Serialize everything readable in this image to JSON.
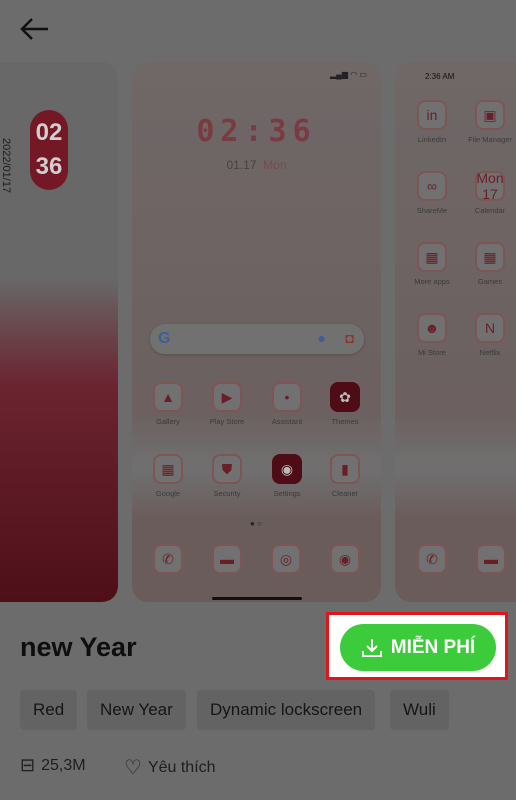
{
  "header": {
    "back_icon": "arrow-left-icon"
  },
  "previews": {
    "lockscreen": {
      "hour": "02",
      "minute": "36",
      "date": "2022/01/17"
    },
    "home": {
      "clock": "02:36",
      "date": "01.17",
      "day": "Mon",
      "apps": [
        {
          "label": "Gallery"
        },
        {
          "label": "Play Store"
        },
        {
          "label": "Assistant"
        },
        {
          "label": "Themes"
        },
        {
          "label": "Google"
        },
        {
          "label": "Security"
        },
        {
          "label": "Settings"
        },
        {
          "label": "Cleaner"
        }
      ]
    },
    "drawer": {
      "time": "2:36 AM",
      "apps": [
        {
          "label": "LinkedIn"
        },
        {
          "label": "File Manager"
        },
        {
          "label": "ShareMe"
        },
        {
          "label": "Calendar"
        },
        {
          "label": "More apps"
        },
        {
          "label": "Games"
        },
        {
          "label": "Mi Store"
        },
        {
          "label": "Netflix"
        }
      ],
      "calendar_icon": {
        "day": "Mon",
        "date": "17"
      }
    }
  },
  "theme": {
    "title": "new Year",
    "download_label": "MIỄN PHÍ",
    "tags": [
      "Red",
      "New Year",
      "Dynamic lockscreen",
      "Wuli"
    ],
    "size": "25,3M",
    "favorite_label": "Yêu thích"
  },
  "colors": {
    "accent": "#3ccb3a",
    "highlight": "#e0141b",
    "overlay": "rgba(0,0,0,0.56)"
  }
}
